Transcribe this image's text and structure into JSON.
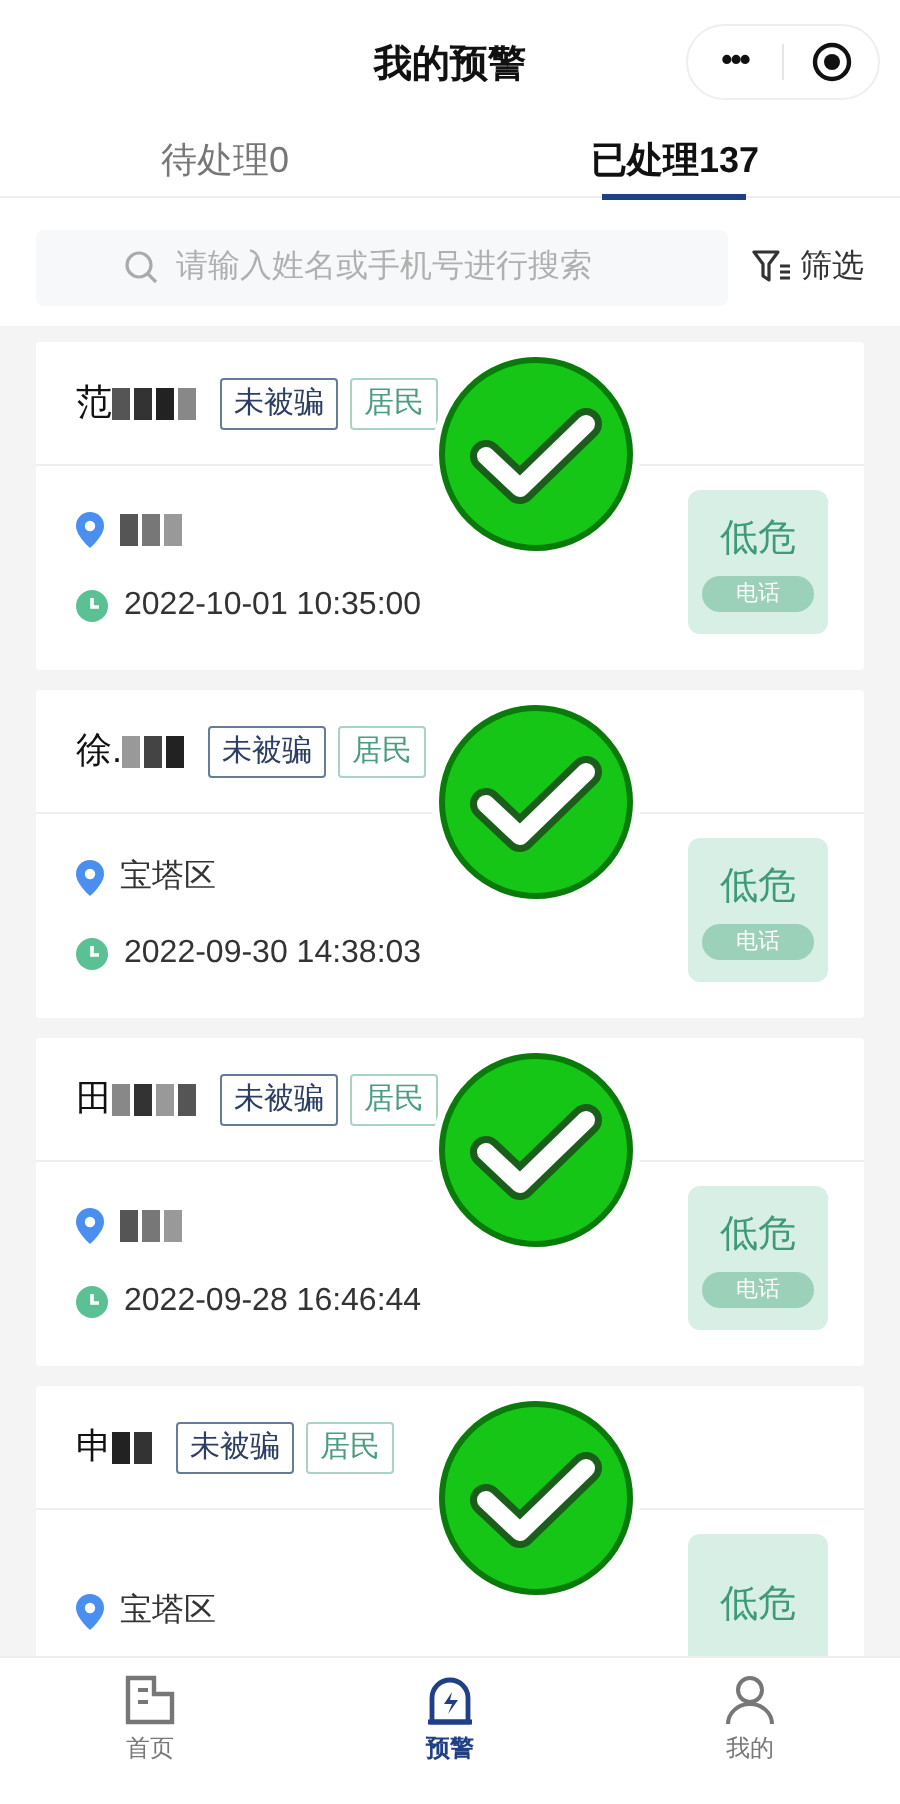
{
  "window": {
    "title": "我的预警",
    "menu_glyph": "•••"
  },
  "tabs": [
    {
      "label": "待处理0",
      "selected": false
    },
    {
      "label": "已处理137",
      "selected": true
    }
  ],
  "search": {
    "placeholder": "请输入姓名或手机号进行搜索"
  },
  "filter": {
    "label": "筛选"
  },
  "cards": [
    {
      "name": "范",
      "tags": [
        {
          "label": "未被骗",
          "kind": "status"
        },
        {
          "label": "居民",
          "kind": "role"
        }
      ],
      "stamped": true,
      "time": "2022-10-01 10:35:00",
      "risk": "低危",
      "channel": "电话"
    },
    {
      "name": "徐.",
      "tags": [
        {
          "label": "未被骗",
          "kind": "status"
        },
        {
          "label": "居民",
          "kind": "role"
        }
      ],
      "stamped": true,
      "address": "宝塔区",
      "time": "2022-09-30 14:38:03",
      "risk": "低危",
      "channel": "电话"
    },
    {
      "name": "田",
      "tags": [
        {
          "label": "未被骗",
          "kind": "status"
        },
        {
          "label": "居民",
          "kind": "role"
        }
      ],
      "stamped": true,
      "time": "2022-09-28 16:46:44",
      "risk": "低危",
      "channel": "电话"
    },
    {
      "name": "申",
      "tags": [
        {
          "label": "未被骗",
          "kind": "status"
        },
        {
          "label": "居民",
          "kind": "role"
        }
      ],
      "stamped": true,
      "address": "宝塔区",
      "risk": "低危"
    }
  ],
  "bottom_nav": [
    {
      "label": "首页",
      "kind": "home",
      "selected": false
    },
    {
      "label": "预警",
      "kind": "alert",
      "selected": true
    },
    {
      "label": "我的",
      "kind": "profile",
      "selected": false
    }
  ]
}
